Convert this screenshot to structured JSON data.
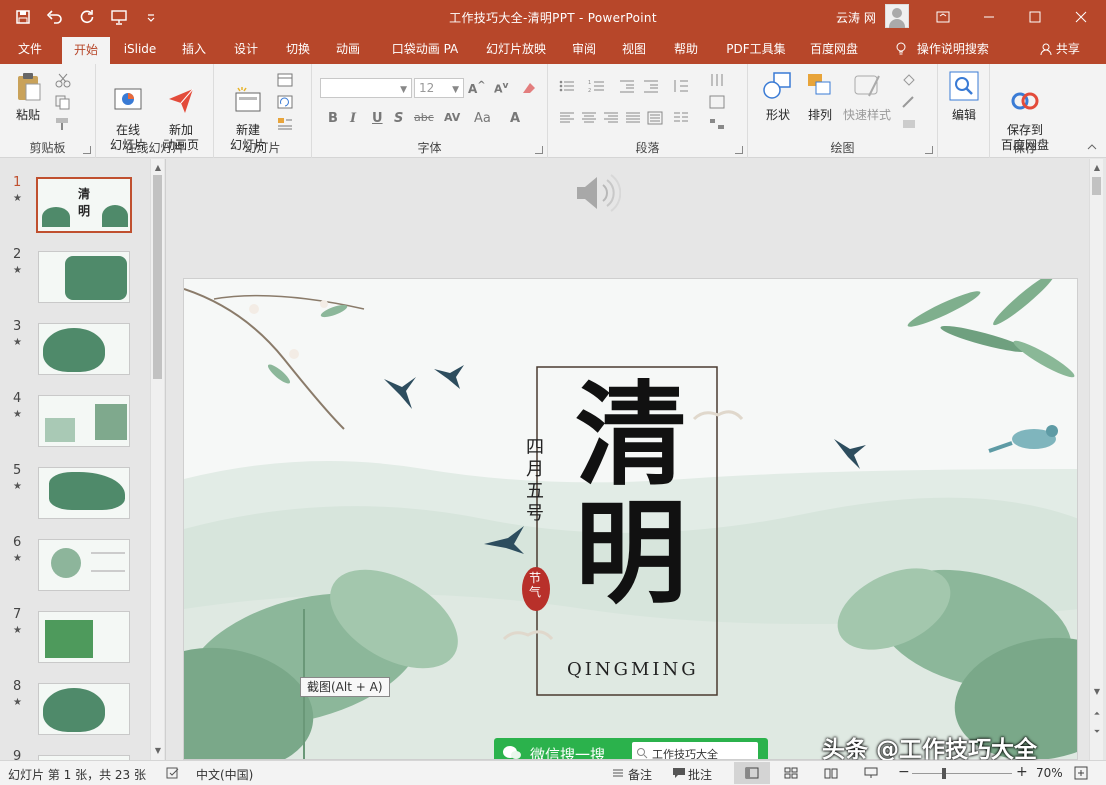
{
  "window": {
    "title": "工作技巧大全-清明PPT - PowerPoint",
    "user": "云涛 网"
  },
  "tabs": [
    "文件",
    "开始",
    "iSlide",
    "插入",
    "设计",
    "切换",
    "动画",
    "口袋动画 PA",
    "幻灯片放映",
    "审阅",
    "视图",
    "帮助",
    "PDF工具集",
    "百度网盘"
  ],
  "active_tab": "开始",
  "tell_me": "操作说明搜索",
  "share": "共享",
  "ribbon": {
    "clipboard": {
      "label": "剪贴板",
      "paste": "粘贴"
    },
    "online_slides": {
      "label": "在线幻灯片",
      "online": "在线\n幻灯片",
      "new_anim": "新加\n动画页"
    },
    "slides": {
      "label": "幻灯片",
      "new_slide": "新建\n幻灯片"
    },
    "font": {
      "label": "字体",
      "size": "12",
      "bold": "B",
      "italic": "I",
      "underline": "U",
      "strike": "S",
      "shadow": "abc",
      "spacing": "AV",
      "case": "Aa",
      "color": "A"
    },
    "paragraph": {
      "label": "段落"
    },
    "drawing": {
      "label": "绘图",
      "shape": "形状",
      "arrange": "排列",
      "quick_style": "快速样式"
    },
    "editing": {
      "edit": "编辑"
    },
    "save": {
      "label": "保存",
      "save_to": "保存到\n百度网盘"
    }
  },
  "thumbnails": [
    {
      "num": "1"
    },
    {
      "num": "2"
    },
    {
      "num": "3"
    },
    {
      "num": "4"
    },
    {
      "num": "5"
    },
    {
      "num": "6"
    },
    {
      "num": "7"
    },
    {
      "num": "8"
    },
    {
      "num": "9"
    }
  ],
  "slide": {
    "title": "清明",
    "date": "四月五号",
    "seal": "节气",
    "roman": "QINGMING",
    "button": "微信搜一搜",
    "search_text": "工作技巧大全"
  },
  "tooltip": "截图(Alt + A)",
  "watermark": "头条 @工作技巧大全",
  "status": {
    "slide_info": "幻灯片 第 1 张，共 23 张",
    "language": "中文(中国)",
    "notes": "备注",
    "comments": "批注",
    "zoom": "70%"
  },
  "colors": {
    "accent": "#b7472a",
    "green": "#4f8a6a"
  }
}
